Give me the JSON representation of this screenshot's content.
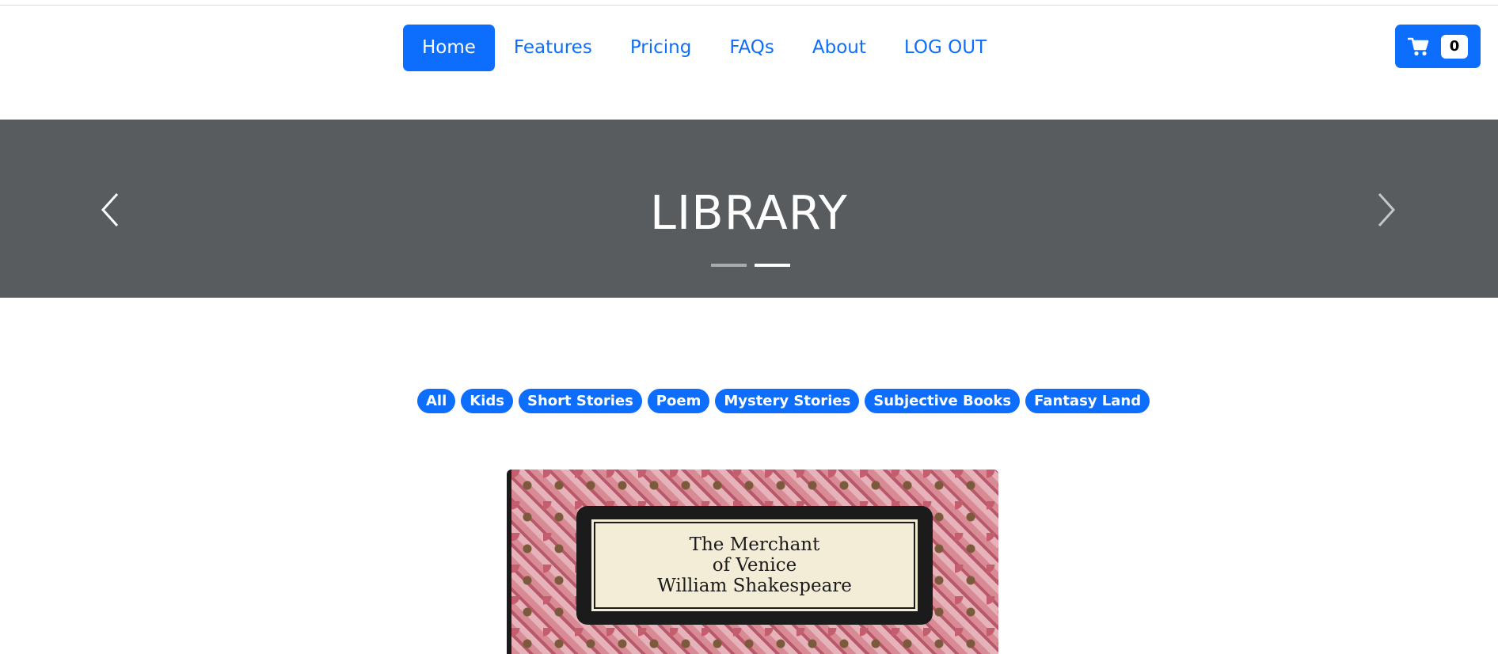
{
  "nav": {
    "items": [
      {
        "label": "Home",
        "active": true
      },
      {
        "label": "Features",
        "active": false
      },
      {
        "label": "Pricing",
        "active": false
      },
      {
        "label": "FAQs",
        "active": false
      },
      {
        "label": "About",
        "active": false
      },
      {
        "label": "LOG OUT",
        "active": false
      }
    ]
  },
  "cart": {
    "count": "0",
    "icon": "cart-icon"
  },
  "banner": {
    "title": "LIBRARY",
    "prev_icon": "chevron-left-icon",
    "next_icon": "chevron-right-icon",
    "slides": 2,
    "active_slide": 2
  },
  "categories": [
    "All",
    "Kids",
    "Short Stories",
    "Poem",
    "Mystery Stories",
    "Subjective Books",
    "Fantasy Land"
  ],
  "book": {
    "title_line1": "The Merchant",
    "title_line2": "of Venice",
    "author": "William Shakespeare"
  },
  "colors": {
    "accent": "#0d6efd",
    "banner": "#595c5f"
  }
}
